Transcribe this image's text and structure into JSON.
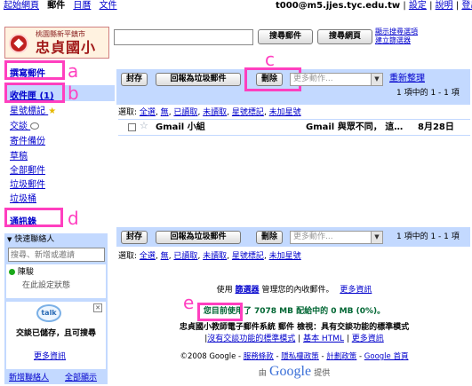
{
  "topbar": {
    "links": [
      "起始網頁",
      "郵件",
      "日曆",
      "文件"
    ],
    "account": "t000@m5.jjes.tyc.edu.tw",
    "account_links": [
      "設定",
      "說明",
      "登出"
    ]
  },
  "logo": {
    "top_text": "桃園縣新平鎮市",
    "name": "忠貞國小"
  },
  "search": {
    "value": "",
    "search_mail_button": "搜尋郵件",
    "search_web_button": "搜尋網頁",
    "options": [
      "顯示搜尋選項",
      "建立篩選器"
    ]
  },
  "sidebar": {
    "compose": "撰寫郵件",
    "inbox": "收件匣 (1)",
    "items": [
      "星號標記",
      "交談",
      "寄件備份",
      "草稿",
      "全部郵件",
      "垃圾郵件",
      "垃圾桶"
    ],
    "contacts": "通訊錄",
    "quick_contacts": {
      "title": "快速聯絡人",
      "search_placeholder": "搜尋、新增或邀請",
      "contact_name": "陳駿",
      "contact_status": "在此設定狀態",
      "talk_logo": "talk",
      "saved_text": "交談已儲存，且可搜尋",
      "more_info": "更多資訊",
      "new_contact": "新增聯絡人",
      "show_all": "全部顯示"
    }
  },
  "toolbar": {
    "archive": "封存",
    "report_spam": "回報為垃圾郵件",
    "delete": "刪除",
    "more_actions": "更多動作...",
    "refresh": "重新整理",
    "count": "1 項中的 1 - 1 項"
  },
  "select_row": {
    "label": "選取:",
    "options": [
      "全選",
      "無",
      "已讀取",
      "未讀取",
      "星號標記",
      "未加星號"
    ]
  },
  "email": {
    "sender": "Gmail 小組",
    "subject": "Gmail 與眾不同， 這…",
    "date": "8月28日"
  },
  "footer": {
    "filter_text_pre": "使用",
    "filter_link": "篩選器",
    "filter_text_post": "管理您的內收郵件。",
    "filter_more": "更多資訊",
    "storage_pre": "您目前使用了",
    "storage_used": "7078 MB",
    "storage_post": "配給中的 0 MB (0%)。",
    "view_line": "忠貞國小教師電子郵件系統 郵件 檢視：具有交談功能的標準模式",
    "view_links": [
      "沒有交談功能的標準模式",
      "基本 HTML",
      "更多資訊"
    ],
    "copyright": "©2008 Google -",
    "legal_links": [
      "服務條款",
      "隱私權政策",
      "計劃政策",
      "Google 首頁"
    ],
    "powered_pre": "由",
    "powered_google": "Google",
    "powered_post": "提供"
  },
  "annotations": [
    "a",
    "b",
    "c",
    "d",
    "e"
  ],
  "colors": {
    "accent": "#c3d9ff",
    "highlight": "#ff3fbf",
    "link": "#0000cc",
    "storage_text": "#006633"
  }
}
